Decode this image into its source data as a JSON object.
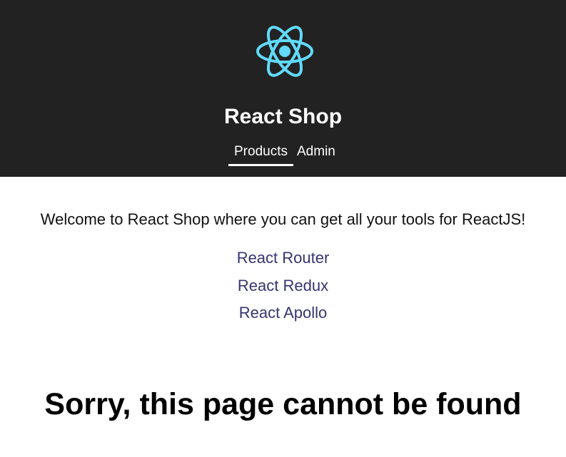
{
  "header": {
    "logo_icon": "react-atom-icon",
    "logo_color": "#61dafb",
    "title": "React Shop",
    "background": "#222222"
  },
  "nav": {
    "items": [
      {
        "label": "Products",
        "active": true
      },
      {
        "label": "Admin",
        "active": false
      }
    ]
  },
  "main": {
    "welcome": "Welcome to React Shop where you can get all your tools for ReactJS!",
    "links": [
      {
        "label": "React Router"
      },
      {
        "label": "React Redux"
      },
      {
        "label": "React Apollo"
      }
    ],
    "link_color": "#353570",
    "error_message": "Sorry, this page cannot be found"
  }
}
